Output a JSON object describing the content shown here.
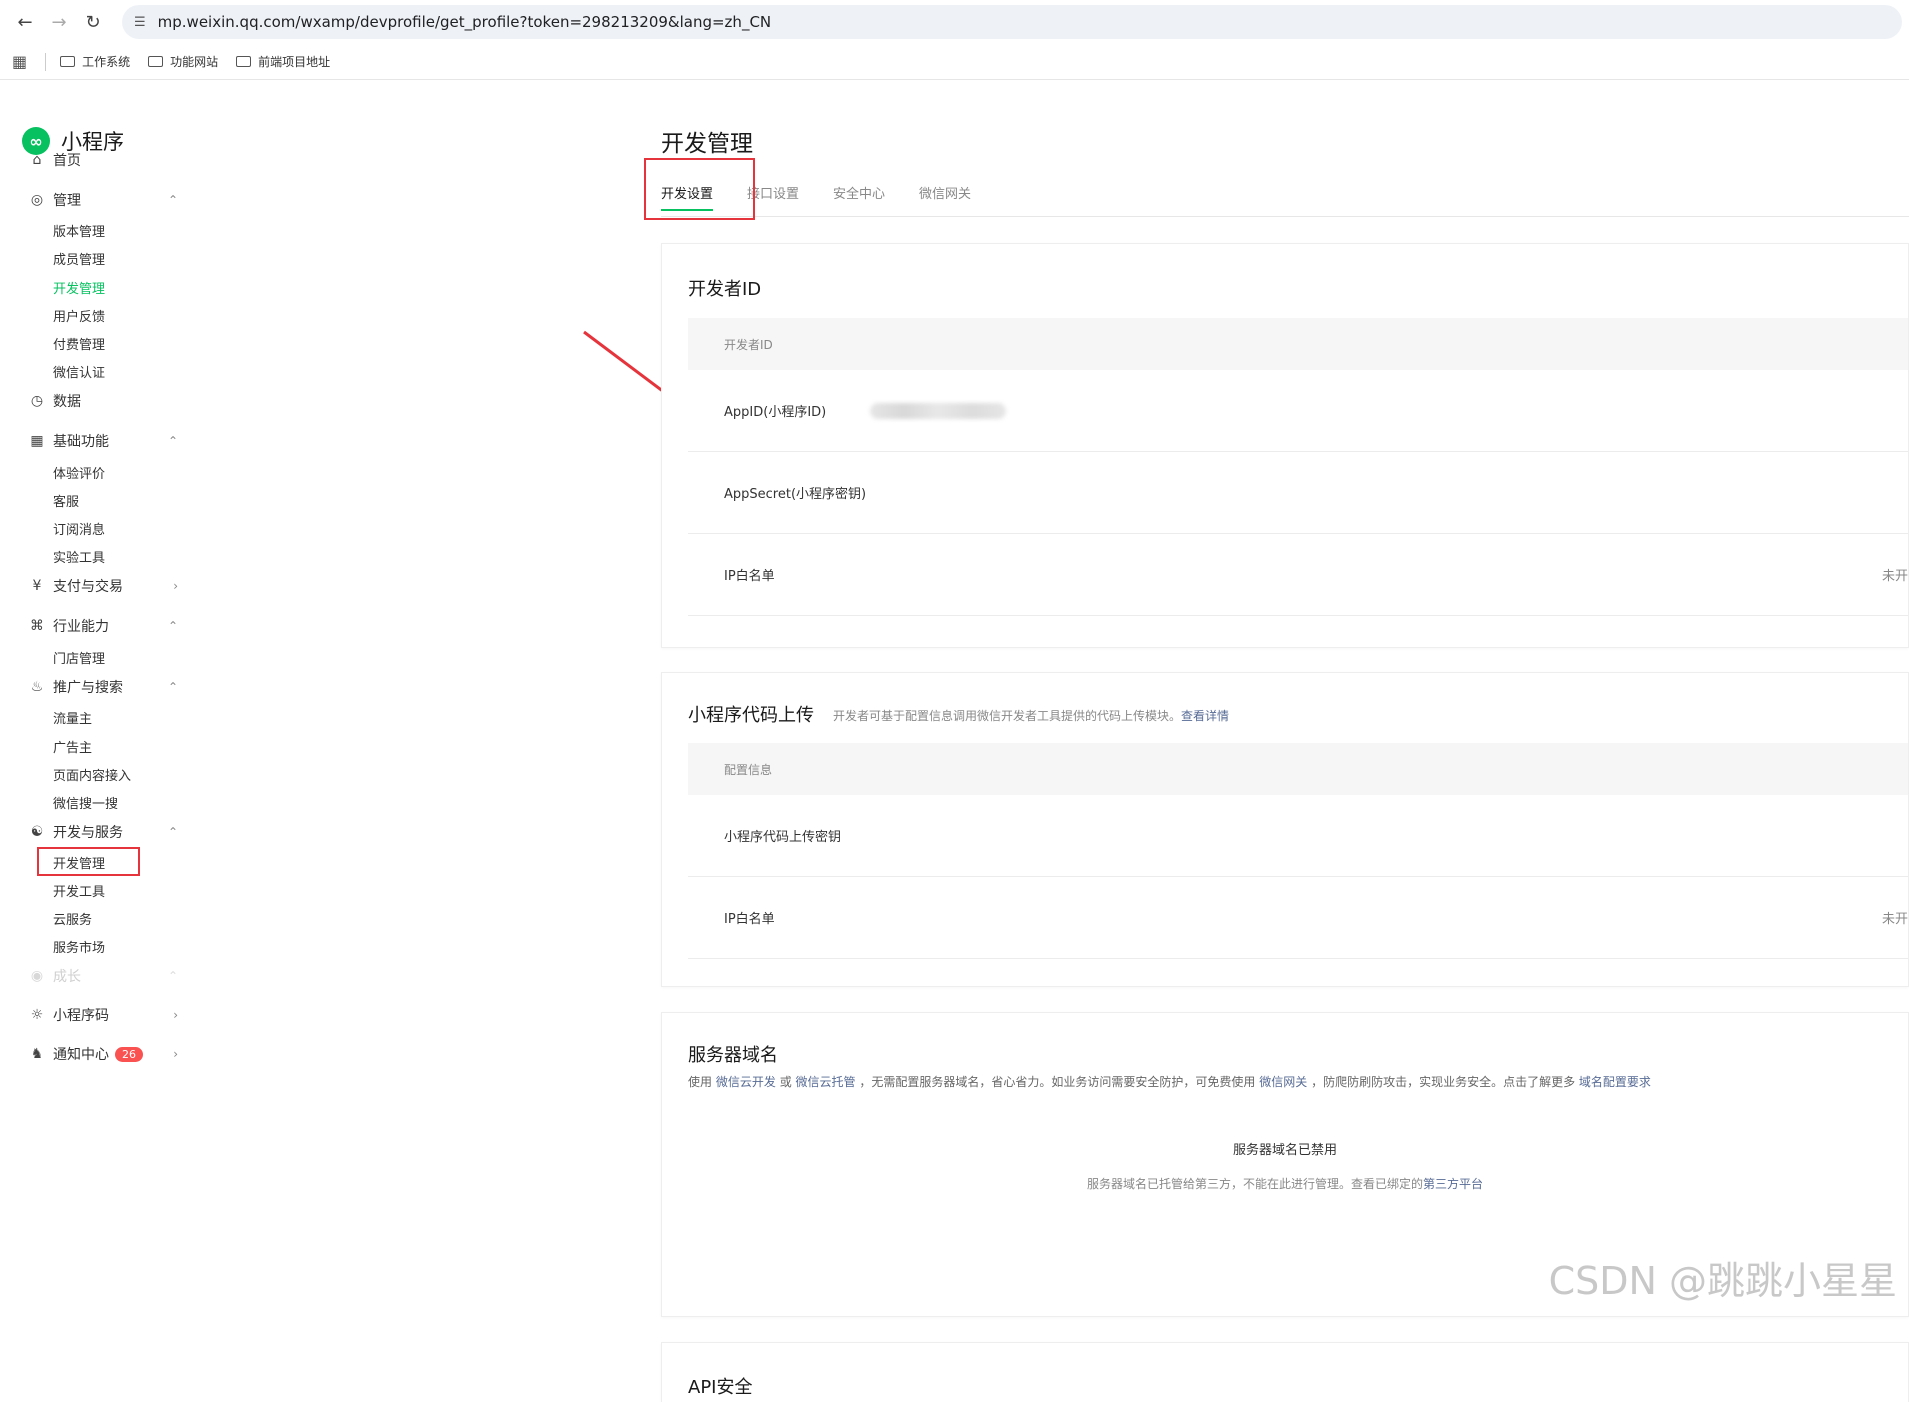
{
  "browser": {
    "url": "mp.weixin.qq.com/wxamp/devprofile/get_profile?token=298213209&lang=zh_CN",
    "bookmarks": [
      "工作系统",
      "功能网站",
      "前端项目地址"
    ]
  },
  "sidebar": {
    "logo": "小程序",
    "home": "首页",
    "manage": {
      "label": "管理",
      "items": [
        "版本管理",
        "成员管理",
        "开发管理",
        "用户反馈",
        "付费管理",
        "微信认证"
      ]
    },
    "data": "数据",
    "basic": {
      "label": "基础功能",
      "items": [
        "体验评价",
        "客服",
        "订阅消息",
        "实验工具"
      ]
    },
    "pay": "支付与交易",
    "industry": {
      "label": "行业能力",
      "items": [
        "门店管理"
      ]
    },
    "promo": {
      "label": "推广与搜索",
      "items": [
        "流量主",
        "广告主",
        "页面内容接入",
        "微信搜一搜"
      ]
    },
    "devsvc": {
      "label": "开发与服务",
      "items": [
        "开发管理",
        "开发工具",
        "云服务",
        "服务市场"
      ]
    },
    "growth": "成长",
    "qrcode": "小程序码",
    "notify": "通知中心",
    "notify_count": "26"
  },
  "page": {
    "title": "开发管理",
    "tabs": [
      "开发设置",
      "接口设置",
      "安全中心",
      "微信网关"
    ]
  },
  "dev_id": {
    "title": "开发者ID",
    "header": "开发者ID",
    "appid_label": "AppID(小程序ID)",
    "secret_label": "AppSecret(小程序密钥)",
    "ip_label": "IP白名单",
    "ip_value": "未开"
  },
  "upload": {
    "title": "小程序代码上传",
    "desc": "开发者可基于配置信息调用微信开发者工具提供的代码上传模块。",
    "desc_link": "查看详情",
    "header": "配置信息",
    "key_label": "小程序代码上传密钥",
    "ip_label": "IP白名单",
    "ip_value": "未开"
  },
  "server": {
    "title": "服务器域名",
    "d1": "使用",
    "l1": "微信云开发",
    "d2": "或",
    "l2": "微信云托管",
    "d3": "，无需配置服务器域名，省心省力。如业务访问需要安全防护，可免费使用",
    "l3": "微信网关",
    "d4": "，防爬防刷防攻击，实现业务安全。点击了解更多",
    "l4": "域名配置要求",
    "disabled_title": "服务器域名已禁用",
    "disabled_desc": "服务器域名已托管给第三方，不能在此进行管理。查看已绑定的",
    "disabled_link": "第三方平台"
  },
  "api": {
    "title": "API安全"
  },
  "watermark": "CSDN @跳跳小星星"
}
